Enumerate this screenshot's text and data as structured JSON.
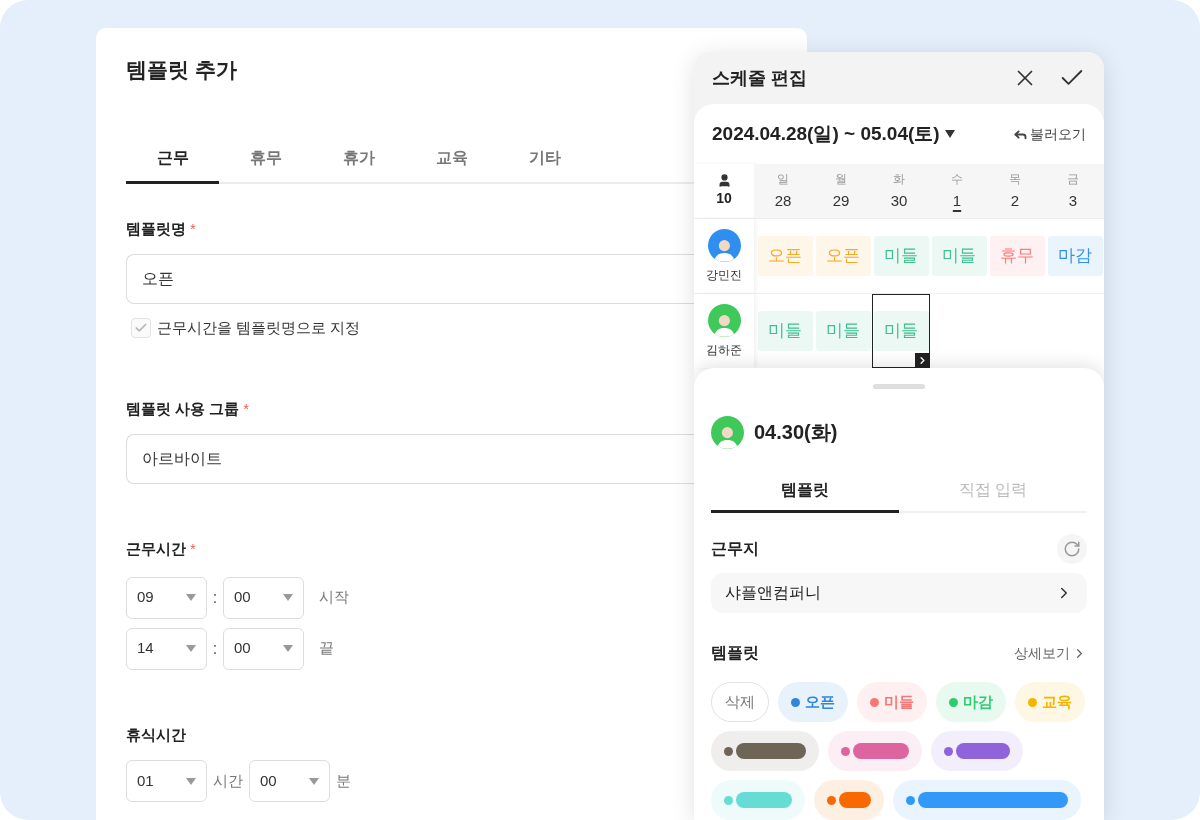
{
  "editor": {
    "title": "템플릿 추가",
    "tabs": [
      {
        "label": "근무",
        "selected": true
      },
      {
        "label": "휴무",
        "selected": false
      },
      {
        "label": "휴가",
        "selected": false
      },
      {
        "label": "교육",
        "selected": false
      },
      {
        "label": "기타",
        "selected": false
      }
    ],
    "name_field": {
      "label": "템플릿명",
      "required_mark": "*",
      "value": "오픈"
    },
    "checkbox": {
      "label": "근무시간을 템플릿명으로 지정",
      "checked": true
    },
    "group_field": {
      "label": "템플릿 사용 그룹",
      "required_mark": "*",
      "value": "아르바이트"
    },
    "work_time": {
      "label": "근무시간",
      "required_mark": "*",
      "rows": [
        {
          "hour": "09",
          "separator": ":",
          "minute": "00",
          "caption": "시작"
        },
        {
          "hour": "14",
          "separator": ":",
          "minute": "00",
          "caption": "끝"
        }
      ]
    },
    "break_time": {
      "label": "휴식시간",
      "hours": "01",
      "hours_unit": "시간",
      "minutes": "00",
      "minutes_unit": "분"
    }
  },
  "schedule": {
    "title": "스케줄 편집",
    "range": "2024.04.28(일) ~ 05.04(토)",
    "load_button": "불러오기",
    "headcount": "10",
    "days": [
      {
        "weekday": "일",
        "date": "28",
        "today": false
      },
      {
        "weekday": "월",
        "date": "29",
        "today": false
      },
      {
        "weekday": "화",
        "date": "30",
        "today": false
      },
      {
        "weekday": "수",
        "date": "1",
        "today": true
      },
      {
        "weekday": "목",
        "date": "2",
        "today": false
      },
      {
        "weekday": "금",
        "date": "3",
        "today": false
      }
    ],
    "people": [
      {
        "name": "강민진",
        "color": "#2f8ff0",
        "shifts": [
          {
            "label": "오픈",
            "color": "#f7a928",
            "selected": false
          },
          {
            "label": "오픈",
            "color": "#f7a928",
            "selected": false
          },
          {
            "label": "미들",
            "color": "#3fbf8f",
            "selected": false
          },
          {
            "label": "미들",
            "color": "#3fbf8f",
            "selected": false
          },
          {
            "label": "휴무",
            "color": "#ff7a7a",
            "selected": false
          },
          {
            "label": "마감",
            "color": "#2f8ff0",
            "selected": false
          }
        ]
      },
      {
        "name": "김하준",
        "color": "#3fc95a",
        "shifts": [
          {
            "label": "미들",
            "color": "#3fbf8f",
            "selected": false
          },
          {
            "label": "미들",
            "color": "#3fbf8f",
            "selected": false
          },
          {
            "label": "미들",
            "color": "#3fbf8f",
            "selected": true
          }
        ]
      }
    ]
  },
  "day_sheet": {
    "date": "04.30(화)",
    "color": "#3fc95a",
    "tabs": [
      {
        "label": "템플릿",
        "selected": true
      },
      {
        "label": "직접 입력",
        "selected": false
      }
    ],
    "workplace": {
      "label": "근무지",
      "value": "샤플앤컴퍼니"
    },
    "templates": {
      "label": "템플릿",
      "detail_link": "상세보기",
      "chips": [
        {
          "kind": "delete",
          "label": "삭제"
        },
        {
          "kind": "label",
          "label": "오픈",
          "color": "#2e86de"
        },
        {
          "kind": "label",
          "label": "미들",
          "color": "#f57878"
        },
        {
          "kind": "label",
          "label": "마감",
          "color": "#2ecc71"
        },
        {
          "kind": "label",
          "label": "교육",
          "color": "#f5b400"
        },
        {
          "kind": "hidden",
          "color": "#6e6557"
        },
        {
          "kind": "hidden",
          "color": "#de64a0"
        },
        {
          "kind": "hidden",
          "color": "#8e63dc"
        },
        {
          "kind": "hidden",
          "color": "#66dcd4"
        },
        {
          "kind": "hidden",
          "color": "#f86a00"
        },
        {
          "kind": "hidden",
          "color": "#3399f8"
        }
      ]
    }
  }
}
